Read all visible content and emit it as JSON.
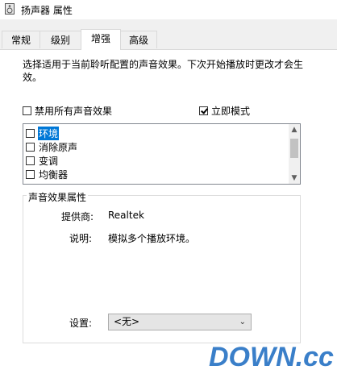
{
  "window": {
    "title": "扬声器 属性"
  },
  "tabs": [
    {
      "label": "常规"
    },
    {
      "label": "级别"
    },
    {
      "label": "增强"
    },
    {
      "label": "高级"
    }
  ],
  "enhancements": {
    "description": "选择适用于当前聆听配置的声音效果。下次开始播放时更改才会生效。",
    "disable_all": {
      "label": "禁用所有声音效果",
      "checked": false
    },
    "immediate_mode": {
      "label": "立即模式",
      "checked": true
    },
    "effects": [
      {
        "label": "环境",
        "checked": false,
        "selected": true
      },
      {
        "label": "消除原声",
        "checked": false,
        "selected": false
      },
      {
        "label": "变调",
        "checked": false,
        "selected": false
      },
      {
        "label": "均衡器",
        "checked": false,
        "selected": false
      }
    ]
  },
  "properties": {
    "group_title": "声音效果属性",
    "provider_label": "提供商:",
    "provider_value": "Realtek",
    "description_label": "说明:",
    "description_value": "模拟多个播放环境。",
    "setting_label": "设置:",
    "setting_value": "<无>"
  },
  "watermark": {
    "text": "DOWN.cc"
  }
}
